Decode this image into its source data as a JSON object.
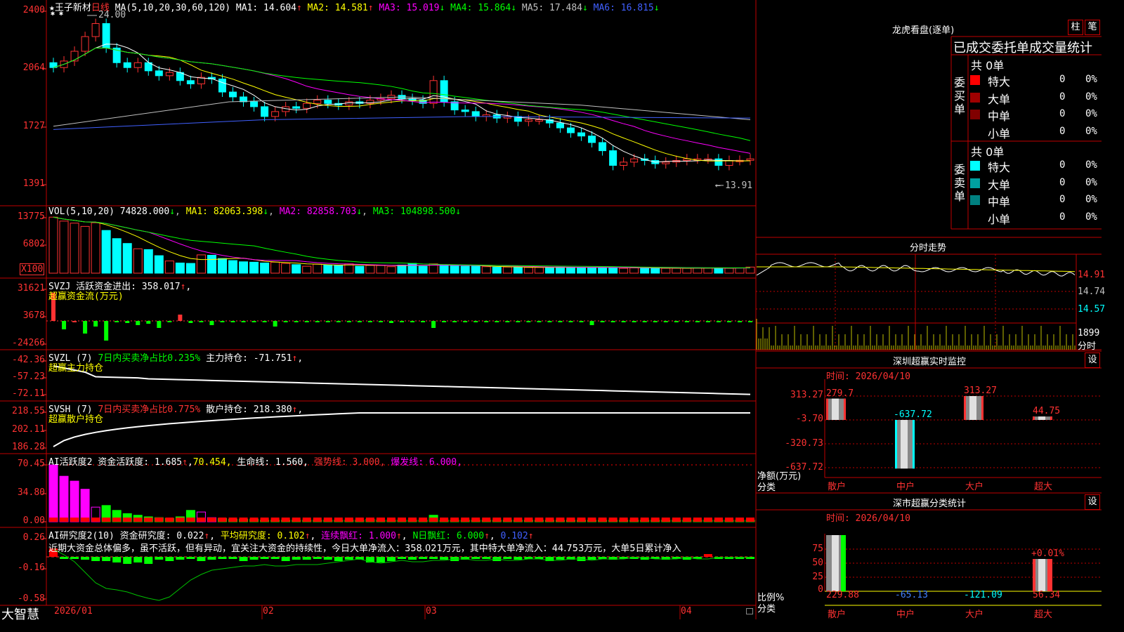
{
  "header": {
    "stock_name": "王子新材",
    "period": "日线",
    "ma_label": "MA(5,10,20,30,60,120)",
    "ma_values": [
      {
        "label": "MA1: 14.604",
        "arrow": "↑",
        "color": "#ffffff"
      },
      {
        "label": "MA2: 14.581",
        "arrow": "↑",
        "color": "#ffff00"
      },
      {
        "label": "MA3: 15.019",
        "arrow": "↓",
        "color": "#ff00ff"
      },
      {
        "label": "MA4: 15.864",
        "arrow": "↓",
        "color": "#00ff00"
      },
      {
        "label": "MA5: 17.484",
        "arrow": "↓",
        "color": "#c0c0c0"
      },
      {
        "label": "MA6: 16.815",
        "arrow": "↓",
        "color": "#4060ff"
      }
    ],
    "high_mark": "24.00",
    "low_mark": "13.91"
  },
  "price_axis": [
    "2400",
    "2064",
    "1727",
    "1391"
  ],
  "vol": {
    "title": "VOL(5,10,20)",
    "value": "74828.000",
    "ma1": "MA1: 82063.398",
    "ma2": "MA2: 82858.703",
    "ma3": "MA3: 104898.500",
    "axis": [
      "13775",
      "6802"
    ],
    "unit": "X100"
  },
  "svzj": {
    "title": "SVZJ  活跃资金进出: 358.017",
    "subtitle": "超赢资金流(万元)",
    "axis": [
      "31621",
      "3678",
      "-24266"
    ]
  },
  "svzl": {
    "title": "SVZL (7) ",
    "ratio": "7日内买卖净占比0.235%",
    "hold": " 主力持仓: -71.751",
    "subtitle": "超赢主力持仓",
    "axis": [
      "-42.36",
      "-57.23",
      "-72.11"
    ]
  },
  "svsh": {
    "title": "SVSH (7) ",
    "ratio": "7日内买卖净占比0.775%",
    "hold": " 散户持仓: 218.380",
    "subtitle": "超赢散户持仓",
    "axis": [
      "218.55",
      "202.11",
      "186.28"
    ]
  },
  "ai1": {
    "title": "AI活跃度2 资金活跃度: 1.685",
    "v2": "70.454,",
    "life": " 生命线: 1.560,",
    "strong": " 强势线: 3.000,",
    "burst": " 爆发线: 6.000,",
    "axis": [
      "70.45",
      "34.80",
      "0.00"
    ]
  },
  "ai2": {
    "title": "AI研究度2(10) 资金研究度: 0.022",
    "avg": " 平均研究度: 0.102",
    "streak": " 连续飘红: 1.000",
    "nday": " N日飘红: 6.000",
    "last": " 0.102",
    "comment": "近期大资金总体偏多，虽不活跃，但有异动，宜关注大资金的持续性，今日大单净流入：358.021万元，其中特大单净流入：44.753万元，大单5日累计净入",
    "axis": [
      "0.26",
      "-0.16",
      "-0.58"
    ]
  },
  "xaxis": {
    "labels": [
      "2026/01",
      "02",
      "03",
      "04"
    ]
  },
  "brand": "大智慧",
  "longhu": {
    "title": "龙虎看盘(逐单)",
    "btn1": "柱",
    "btn2": "笔",
    "header": "已成交委托单成交量统计",
    "buy_total": "共 0单",
    "buy_label": "委买单",
    "sell_total": "共 0单",
    "sell_label": "委卖单",
    "buy_rows": [
      {
        "name": "特大",
        "count": "0",
        "pct": "0%",
        "color": "#ff0000"
      },
      {
        "name": "大单",
        "count": "0",
        "pct": "0%",
        "color": "#a00000"
      },
      {
        "name": "中单",
        "count": "0",
        "pct": "0%",
        "color": "#800000"
      },
      {
        "name": "小单",
        "count": "0",
        "pct": "0%",
        "color": "#000000"
      }
    ],
    "sell_rows": [
      {
        "name": "特大",
        "count": "0",
        "pct": "0%",
        "color": "#00ffff"
      },
      {
        "name": "大单",
        "count": "0",
        "pct": "0%",
        "color": "#00a0a0"
      },
      {
        "name": "中单",
        "count": "0",
        "pct": "0%",
        "color": "#008080"
      },
      {
        "name": "小单",
        "count": "0",
        "pct": "0%",
        "color": "#000000"
      }
    ]
  },
  "intraday": {
    "title": "分时走势",
    "axis": [
      "14.91",
      "14.74",
      "14.57"
    ],
    "vol_label": "1899",
    "unit": "分时"
  },
  "monitor": {
    "title": "深圳超赢实时监控",
    "btn": "设",
    "time": "时间: 2026/04/10",
    "axis": [
      "313.27",
      "-3.70",
      "-320.73",
      "-637.72"
    ],
    "ylabel": "净额(万元)",
    "xlabel": "分类",
    "cats": [
      "散户",
      "中户",
      "大户",
      "超大"
    ]
  },
  "classify": {
    "title": "深市超赢分类统计",
    "btn": "设",
    "time": "时间: 2026/04/10",
    "axis": [
      "75",
      "50",
      "25",
      "0"
    ],
    "ylabel": "比例%",
    "xlabel": "分类",
    "cats": [
      "散户",
      "中户",
      "大户",
      "超大"
    ],
    "annot": "+0.01%"
  },
  "chart_data": [
    {
      "type": "candlestick",
      "title": "王子新材 日线",
      "ylim": [
        13.91,
        24.0
      ],
      "x_labels": [
        "2026/01",
        "02",
        "03",
        "04"
      ],
      "high": 24.0,
      "low": 13.91,
      "closes": [
        20.6,
        21.0,
        21.6,
        22.5,
        23.3,
        21.8,
        20.9,
        20.6,
        20.9,
        20.4,
        20.1,
        20.3,
        19.8,
        19.6,
        20.0,
        19.9,
        19.1,
        18.8,
        18.5,
        18.2,
        17.6,
        17.9,
        18.2,
        18.1,
        18.4,
        18.6,
        18.4,
        18.3,
        18.5,
        18.4,
        18.6,
        18.7,
        18.9,
        18.7,
        18.6,
        18.4,
        19.8,
        18.5,
        18.0,
        17.9,
        17.6,
        17.7,
        17.5,
        17.6,
        17.3,
        17.4,
        17.4,
        17.2,
        16.9,
        16.6,
        16.4,
        16.0,
        15.5,
        14.6,
        14.8,
        15.0,
        14.9,
        14.7,
        14.8,
        14.9,
        15.0,
        15.0,
        15.0,
        14.6,
        14.9,
        14.91,
        15.0
      ]
    },
    {
      "type": "bar",
      "title": "VOL(5,10,20)",
      "values": [
        13775,
        12800,
        12300,
        11500,
        12400,
        10500,
        8500,
        7300,
        6000,
        5800,
        4300,
        3000,
        2500,
        2400,
        4500,
        4400,
        3600,
        3100,
        2800,
        2700,
        2500,
        2700,
        2400,
        2100,
        1700,
        2200,
        2000,
        1900,
        2300,
        1700,
        1900,
        1900,
        1600,
        2000,
        2400,
        1700,
        2300,
        2000,
        1800,
        1700,
        1700,
        1600,
        1500,
        1500,
        1400,
        1400,
        1400,
        1400,
        1500,
        1400,
        1400,
        1400,
        1400,
        1400,
        1200,
        1300,
        1300,
        1300,
        1200,
        1200,
        1200,
        1300,
        1300,
        1300,
        1200,
        1300,
        1500
      ]
    },
    {
      "type": "bar",
      "title": "SVZJ 超赢资金流(万元)",
      "ylim": [
        -24266,
        31621
      ]
    }
  ]
}
